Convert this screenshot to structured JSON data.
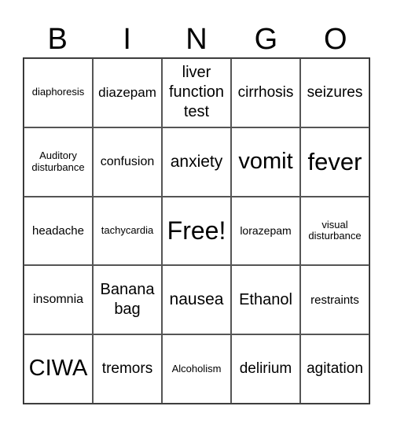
{
  "header": [
    "B",
    "I",
    "N",
    "G",
    "O"
  ],
  "cells": [
    "diaphoresis",
    "diazepam",
    "liver function test",
    "cirrhosis",
    "seizures",
    "Auditory disturbance",
    "confusion",
    "anxiety",
    "vomit",
    "fever",
    "headache",
    "tachycardia",
    "Free!",
    "lorazepam",
    "visual disturbance",
    "insomnia",
    "Banana bag",
    "nausea",
    "Ethanol",
    "restraints",
    "CIWA",
    "tremors",
    "Alcoholism",
    "delirium",
    "agitation"
  ]
}
